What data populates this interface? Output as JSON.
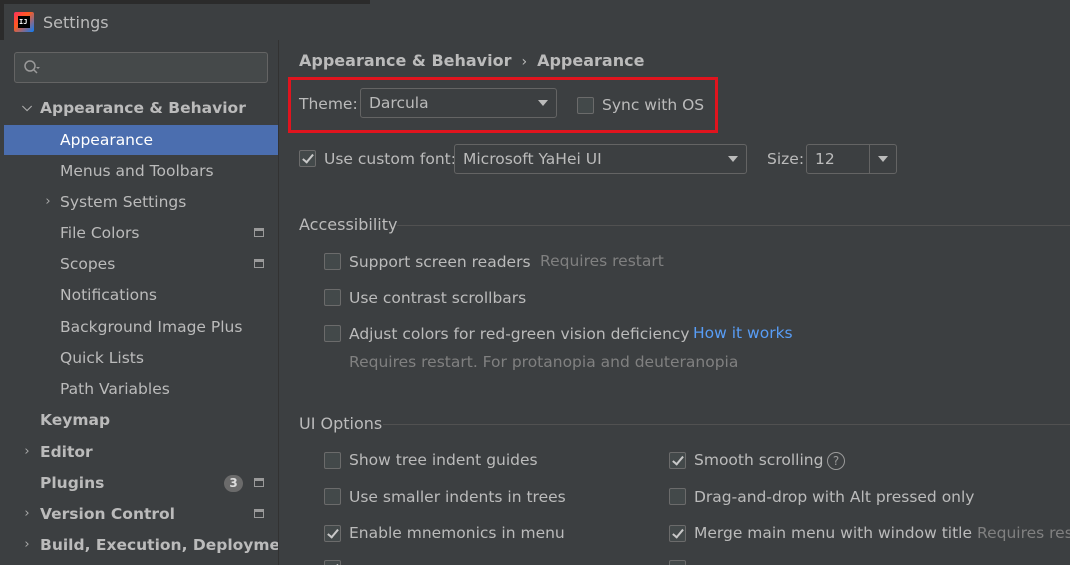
{
  "window": {
    "title": "Settings",
    "app_icon": "intellij-idea-icon",
    "app_icon_text": "IJ"
  },
  "sidebar": {
    "search_placeholder": "",
    "items": [
      {
        "label": "Appearance & Behavior",
        "expanded": true
      },
      {
        "label": "Appearance",
        "selected": true
      },
      {
        "label": "Menus and Toolbars"
      },
      {
        "label": "System Settings",
        "expandable": true
      },
      {
        "label": "File Colors",
        "project_icon": true
      },
      {
        "label": "Scopes",
        "project_icon": true
      },
      {
        "label": "Notifications"
      },
      {
        "label": "Background Image Plus"
      },
      {
        "label": "Quick Lists"
      },
      {
        "label": "Path Variables"
      },
      {
        "label": "Keymap"
      },
      {
        "label": "Editor",
        "expandable": true
      },
      {
        "label": "Plugins",
        "badge": "3",
        "project_icon": true
      },
      {
        "label": "Version Control",
        "expandable": true,
        "project_icon": true
      },
      {
        "label": "Build, Execution, Deployment",
        "expandable": true
      }
    ]
  },
  "breadcrumb": {
    "parent": "Appearance & Behavior",
    "separator": "›",
    "current": "Appearance"
  },
  "theme": {
    "label": "Theme:",
    "value": "Darcula",
    "sync_label": "Sync with OS",
    "sync_checked": false
  },
  "font": {
    "checkbox_label": "Use custom font:",
    "checked": true,
    "value": "Microsoft YaHei UI",
    "size_label": "Size:",
    "size_value": "12"
  },
  "accessibility": {
    "title": "Accessibility",
    "screen_readers": {
      "label": "Support screen readers",
      "hint": "Requires restart",
      "checked": false
    },
    "contrast_scrollbars": {
      "label": "Use contrast scrollbars",
      "checked": false
    },
    "red_green": {
      "label": "Adjust colors for red-green vision deficiency",
      "link": "How it works",
      "checked": false,
      "hint": "Requires restart. For protanopia and deuteranopia"
    }
  },
  "ui_options": {
    "title": "UI Options",
    "tree_indent": {
      "label": "Show tree indent guides",
      "checked": false
    },
    "smaller_indents": {
      "label": "Use smaller indents in trees",
      "checked": false
    },
    "mnemonics_menu": {
      "label": "Enable mnemonics in menu",
      "checked": true
    },
    "smooth_scrolling": {
      "label": "Smooth scrolling",
      "checked": true,
      "help": "?"
    },
    "drag_drop_alt": {
      "label": "Drag-and-drop with Alt pressed only",
      "checked": false
    },
    "merge_menu": {
      "label": "Merge main menu with window title",
      "hint": "Requires rest",
      "checked": true
    }
  },
  "colors": {
    "background": "#3c3f41",
    "selection": "#4b6eaf",
    "link": "#589df6",
    "highlight_box": "#e0141e"
  }
}
